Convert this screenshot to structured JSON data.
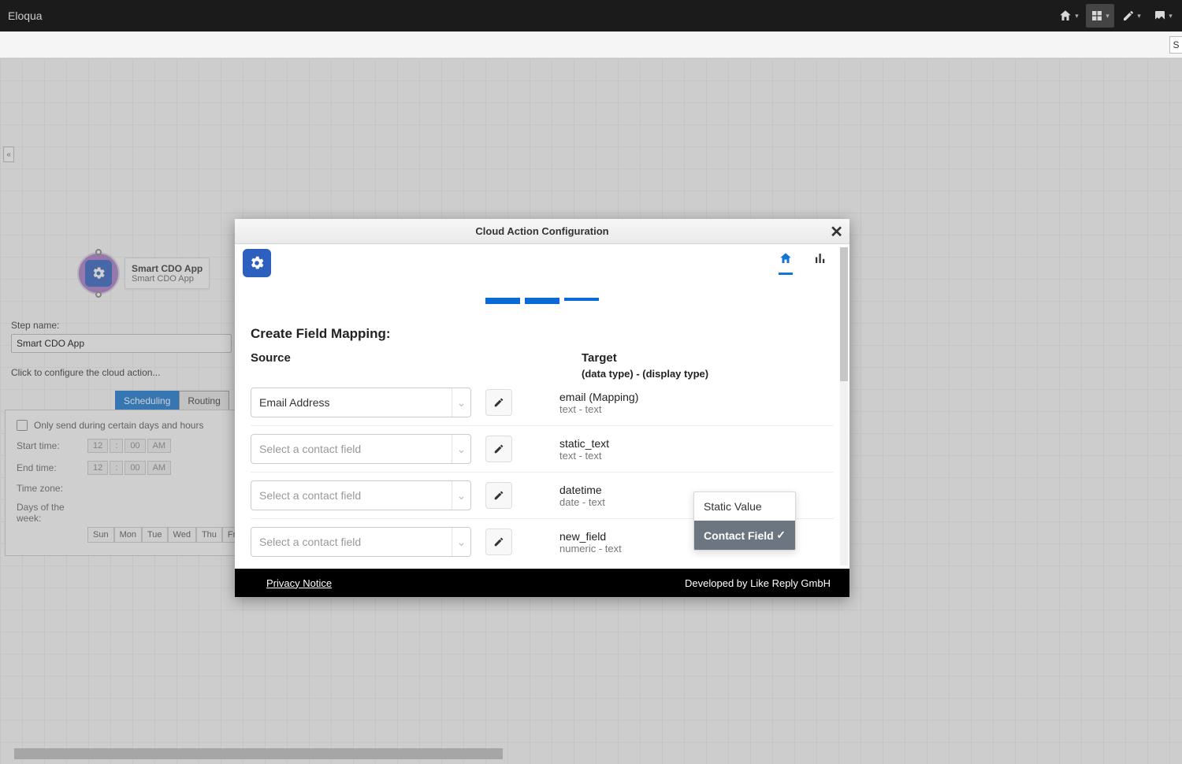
{
  "topbar": {
    "brand": "Eloqua"
  },
  "secbar": {
    "stub": "S"
  },
  "step": {
    "title": "Smart CDO App",
    "subtitle": "Smart CDO App"
  },
  "cfg": {
    "stepname_label": "Step name:",
    "stepname_value": "Smart CDO App",
    "hint": "Click to configure the cloud action..."
  },
  "tabs": {
    "scheduling": "Scheduling",
    "routing": "Routing"
  },
  "sched": {
    "checkbox": "Only send during certain days and hours",
    "start": "Start time:",
    "end": "End time:",
    "tz": "Time zone:",
    "dow": "Days of the week:",
    "time_h": "12",
    "time_m": "00",
    "time_ampm": "AM",
    "days": [
      "Sun",
      "Mon",
      "Tue",
      "Wed",
      "Thu",
      "Fri"
    ]
  },
  "modal": {
    "title": "Cloud Action Configuration",
    "section": "Create Field Mapping:",
    "source": "Source",
    "target": "Target",
    "target_sub": "(data type) - (display type)",
    "rows": [
      {
        "source": "Email Address",
        "ph": false,
        "t1": "email (Mapping)",
        "t2": "text - text"
      },
      {
        "source": "Select a contact field",
        "ph": true,
        "t1": "static_text",
        "t2": "text - text"
      },
      {
        "source": "Select a contact field",
        "ph": true,
        "t1": "datetime",
        "t2": "date - text"
      },
      {
        "source": "Select a contact field",
        "ph": true,
        "t1": "new_field",
        "t2": "numeric - text"
      }
    ],
    "popover": {
      "opt1": "Static Value",
      "opt2": "Contact Field"
    },
    "footer": {
      "privacy": "Privacy Notice",
      "credit": "Developed by Like Reply GmbH"
    }
  }
}
